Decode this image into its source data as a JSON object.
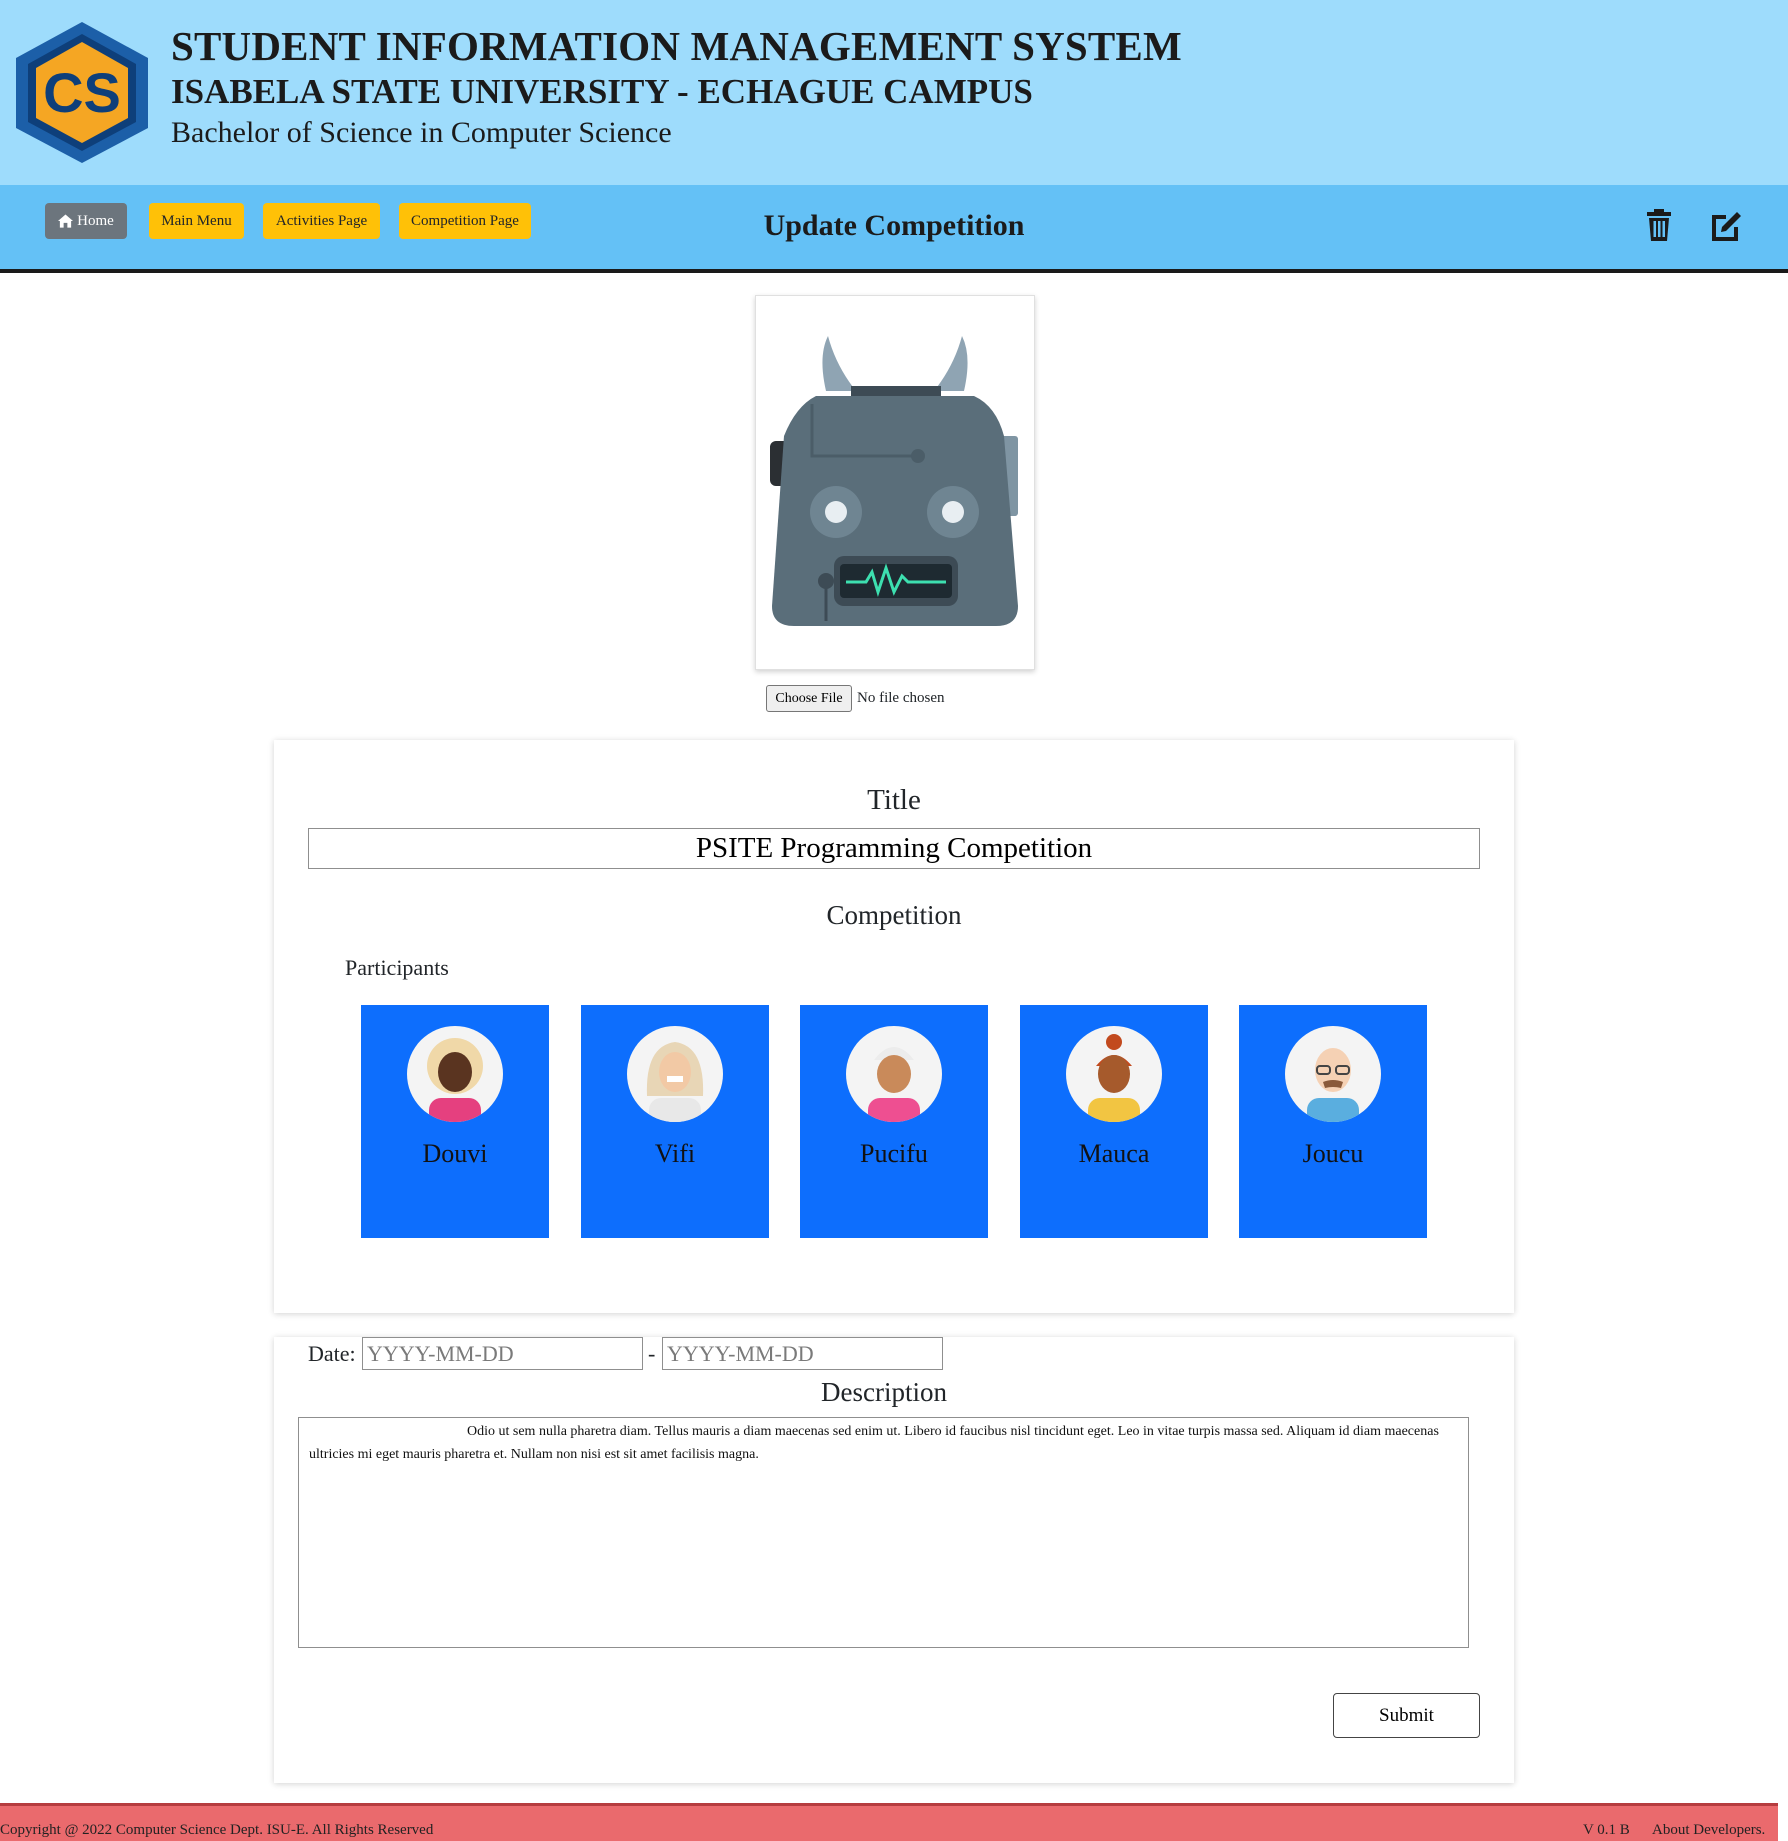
{
  "header": {
    "system_title": "STUDENT INFORMATION MANAGEMENT SYSTEM",
    "university": "ISABELA STATE UNIVERSITY - ECHAGUE CAMPUS",
    "program": "Bachelor of Science in Computer Science",
    "logo_text": "CS",
    "logo_colors": {
      "outer": "#1c5fa8",
      "inner": "#f5a623"
    }
  },
  "nav": {
    "home_label": "Home",
    "main_menu_label": "Main Menu",
    "activities_label": "Activities Page",
    "competition_label": "Competition Page",
    "page_title": "Update Competition",
    "icons": [
      "home-icon",
      "trash-icon",
      "edit-icon"
    ]
  },
  "image_upload": {
    "image_icon": "robot-illustration",
    "choose_file_label": "Choose File",
    "file_status": "No file chosen"
  },
  "form": {
    "title_label": "Title",
    "title_value": "PSITE Programming Competition",
    "type_label": "Competition",
    "participants_label": "Participants",
    "participants": [
      {
        "name": "Douvi",
        "skin": "#5a3420",
        "hair": "#f0d8a8",
        "shirt": "#e5407f"
      },
      {
        "name": "Vifi",
        "skin": "#f2c9a5",
        "hair": "#e8d6b6",
        "shirt": "#e8e8e8"
      },
      {
        "name": "Pucifu",
        "skin": "#c98a5a",
        "hair": "#ececec",
        "shirt": "#ee4f91"
      },
      {
        "name": "Mauca",
        "skin": "#a65a2c",
        "hair": "#c24a1e",
        "shirt": "#f2c542"
      },
      {
        "name": "Joucu",
        "skin": "#f5d1b4",
        "hair": "#f5d1b4",
        "shirt": "#5aaedf"
      }
    ],
    "date_label": "Date:",
    "date_start_placeholder": "YYYY-MM-DD",
    "date_end_placeholder": "YYYY-MM-DD",
    "date_separator": "-",
    "description_label": "Description",
    "description_value": "Odio ut sem nulla pharetra diam. Tellus mauris a diam maecenas sed enim ut. Libero id faucibus nisl tincidunt eget. Leo in vitae turpis massa sed. Aliquam id diam maecenas ultricies mi eget mauris pharetra et. Nullam non nisi est sit amet facilisis magna.",
    "submit_label": "Submit"
  },
  "footer": {
    "copyright": "Copyright @ 2022 Computer Science Dept. ISU-E. All Rights Reserved",
    "version": "V 0.1 B",
    "about": "About Developers."
  },
  "colors": {
    "header_bg": "#9edcfc",
    "nav_bg": "#64c1f6",
    "home_btn": "#6c757d",
    "nav_btn": "#ffc107",
    "participant_card": "#0d6efd",
    "footer_bg": "#ea6a6d"
  }
}
